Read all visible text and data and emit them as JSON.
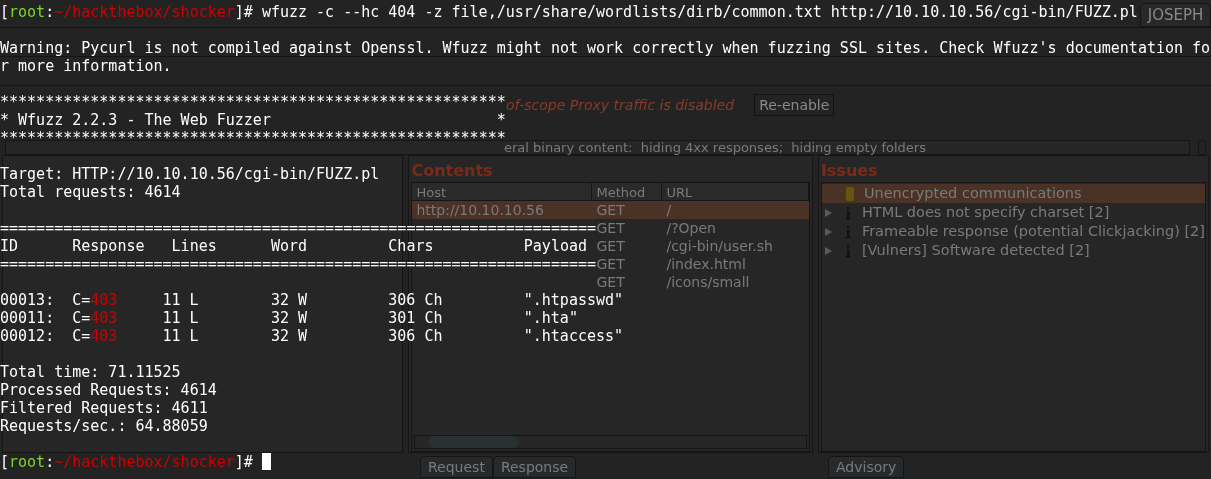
{
  "burp": {
    "corner_tab": "JOSEPH",
    "notice": {
      "message": "of-scope Proxy traffic is disabled",
      "button": "Re-enable"
    },
    "filter": "eral binary content:  hiding 4xx responses;  hiding empty folders",
    "contents": {
      "title": "Contents",
      "columns": [
        "Host",
        "Method",
        "URL"
      ],
      "rows": [
        {
          "host": "http://10.10.10.56",
          "method": "GET",
          "url": "/",
          "selected": true
        },
        {
          "method": "GET",
          "url": "/?Open",
          "selected": false
        },
        {
          "method": "GET",
          "url": "/cgi-bin/user.sh",
          "selected": false
        },
        {
          "method": "GET",
          "url": "/index.html",
          "selected": false
        },
        {
          "method": "GET",
          "url": "/icons/small",
          "selected": false
        }
      ]
    },
    "issues": {
      "title": "Issues",
      "items": [
        {
          "label": "Unencrypted communications",
          "kind": "warning",
          "selected": true
        },
        {
          "label": "HTML does not specify charset [2]",
          "kind": "info",
          "selected": false
        },
        {
          "label": "Frameable response (potential Clickjacking) [2]",
          "kind": "info",
          "selected": false
        },
        {
          "label": "[Vulners] Software detected [2]",
          "kind": "info",
          "selected": false
        }
      ]
    },
    "bottom_tabs": {
      "left": [
        "Request",
        "Response"
      ],
      "right": [
        "Advisory"
      ]
    }
  },
  "terminal": {
    "lines": [
      {
        "kind": "prompt",
        "open": "[",
        "user": "root",
        "sep": ":",
        "path": "~/hackthebox/shocker",
        "close": "]#",
        "command": "wfuzz -c --hc 404 -z file,/usr/share/wordlists/dirb/common.txt http://10.10.10.56/cgi-bin/FUZZ.pl",
        "cursor": false
      },
      {
        "kind": "blank"
      },
      {
        "kind": "text",
        "text": "Warning: Pycurl is not compiled against Openssl. Wfuzz might not work correctly when fuzzing SSL sites. Check Wfuzz's documentation fo"
      },
      {
        "kind": "text",
        "text": "r more information."
      },
      {
        "kind": "blank"
      },
      {
        "kind": "text",
        "text": "********************************************************"
      },
      {
        "kind": "text",
        "text": "* Wfuzz 2.2.3 - The Web Fuzzer                         *"
      },
      {
        "kind": "text",
        "text": "********************************************************"
      },
      {
        "kind": "blank"
      },
      {
        "kind": "text",
        "text": "Target: HTTP://10.10.10.56/cgi-bin/FUZZ.pl"
      },
      {
        "kind": "text",
        "text": "Total requests: 4614"
      },
      {
        "kind": "blank"
      },
      {
        "kind": "text",
        "text": "=================================================================="
      },
      {
        "kind": "text",
        "text": "ID      Response   Lines      Word         Chars          Payload"
      },
      {
        "kind": "text",
        "text": "=================================================================="
      },
      {
        "kind": "blank"
      },
      {
        "kind": "result",
        "id": "00013:",
        "code_prefix": "C=",
        "code": "403",
        "lines": "11 L",
        "words": "32 W",
        "chars": "306 Ch",
        "payload": "\".htpasswd\""
      },
      {
        "kind": "result",
        "id": "00011:",
        "code_prefix": "C=",
        "code": "403",
        "lines": "11 L",
        "words": "32 W",
        "chars": "301 Ch",
        "payload": "\".hta\""
      },
      {
        "kind": "result",
        "id": "00012:",
        "code_prefix": "C=",
        "code": "403",
        "lines": "11 L",
        "words": "32 W",
        "chars": "306 Ch",
        "payload": "\".htaccess\""
      },
      {
        "kind": "blank"
      },
      {
        "kind": "text",
        "text": "Total time: 71.11525"
      },
      {
        "kind": "text",
        "text": "Processed Requests: 4614"
      },
      {
        "kind": "text",
        "text": "Filtered Requests: 4611"
      },
      {
        "kind": "text",
        "text": "Requests/sec.: 64.88059"
      },
      {
        "kind": "blank"
      },
      {
        "kind": "prompt",
        "open": "[",
        "user": "root",
        "sep": ":",
        "path": "~/hackthebox/shocker",
        "close": "]#",
        "cursor": true
      }
    ]
  }
}
